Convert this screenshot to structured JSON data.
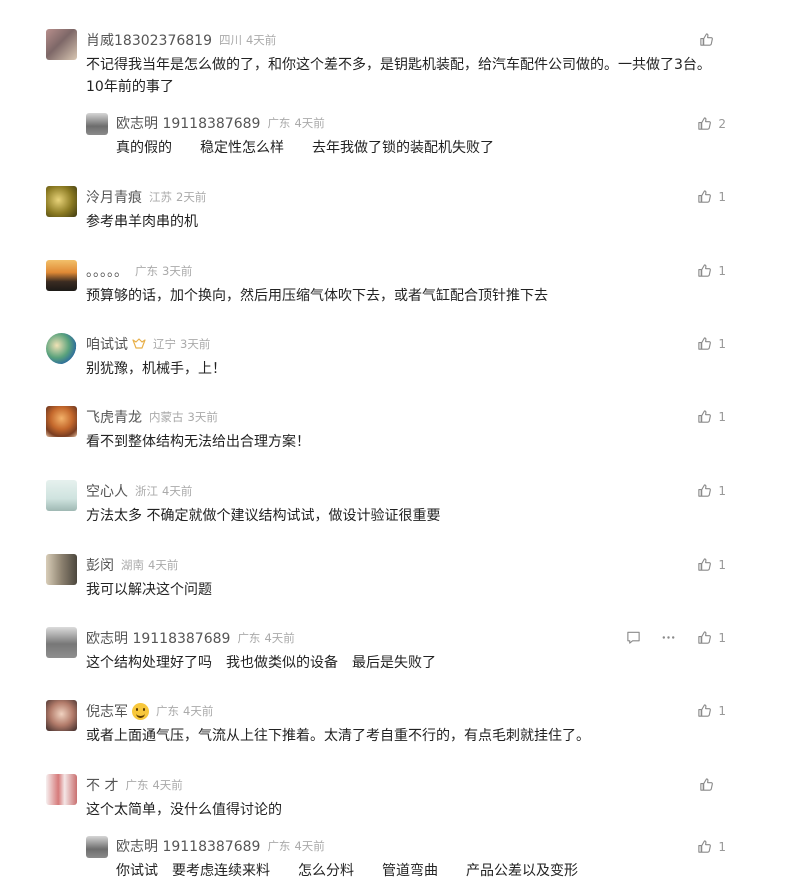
{
  "comments": [
    {
      "user": "肖威18302376819",
      "region": "四川",
      "time": "4天前",
      "text": "不记得我当年是怎么做的了，和你这个差不多，是钥匙机装配，给汽车配件公司做的。一共做了3台。10年前的事了",
      "likes": ""
    },
    {
      "user": "欧志明 19118387689",
      "region": "广东",
      "time": "4天前",
      "text": "真的假的　　稳定性怎么样　　去年我做了锁的装配机失败了",
      "likes": "2"
    },
    {
      "user": "泠月青痕",
      "region": "江苏",
      "time": "2天前",
      "text": "参考串羊肉串的机",
      "likes": "1"
    },
    {
      "user": "。。。。。",
      "region": "广东",
      "time": "3天前",
      "text": "预算够的话，加个换向，然后用压缩气体吹下去，或者气缸配合顶针推下去",
      "likes": "1"
    },
    {
      "user": "咱试试",
      "region": "辽宁",
      "time": "3天前",
      "text": "别犹豫，机械手，上！",
      "likes": "1"
    },
    {
      "user": "飞虎青龙",
      "region": "内蒙古",
      "time": "3天前",
      "text": "看不到整体结构无法给出合理方案！",
      "likes": "1"
    },
    {
      "user": "空心人",
      "region": "浙江",
      "time": "4天前",
      "text": "方法太多  不确定就做个建议结构试试，做设计验证很重要",
      "likes": "1"
    },
    {
      "user": "彭闵",
      "region": "湖南",
      "time": "4天前",
      "text": "我可以解决这个问题",
      "likes": "1"
    },
    {
      "user": "欧志明 19118387689",
      "region": "广东",
      "time": "4天前",
      "text": "这个结构处理好了吗　我也做类似的设备　最后是失败了",
      "likes": "1"
    },
    {
      "user": "倪志军",
      "region": "广东",
      "time": "4天前",
      "text": "或者上面通气压，气流从上往下推着。太清了考自重不行的，有点毛刺就挂住了。",
      "likes": "1"
    },
    {
      "user": "不 才",
      "region": "广东",
      "time": "4天前",
      "text": "这个太简单，没什么值得讨论的",
      "likes": ""
    },
    {
      "user": "欧志明 19118387689",
      "region": "广东",
      "time": "4天前",
      "text": "你试试　要考虑连续来料　　怎么分料　　管道弯曲　　产品公差以及变形",
      "likes": "1"
    }
  ],
  "icons": {
    "like": "thumbs-up-icon",
    "reply": "reply-icon",
    "more": "more-icon",
    "vip": "vip-badge-icon",
    "emoji": "smile-emoji-icon"
  },
  "colors": {
    "name": "#555555",
    "meta": "#aaaaaa",
    "text": "#222222",
    "icon": "#999999"
  }
}
